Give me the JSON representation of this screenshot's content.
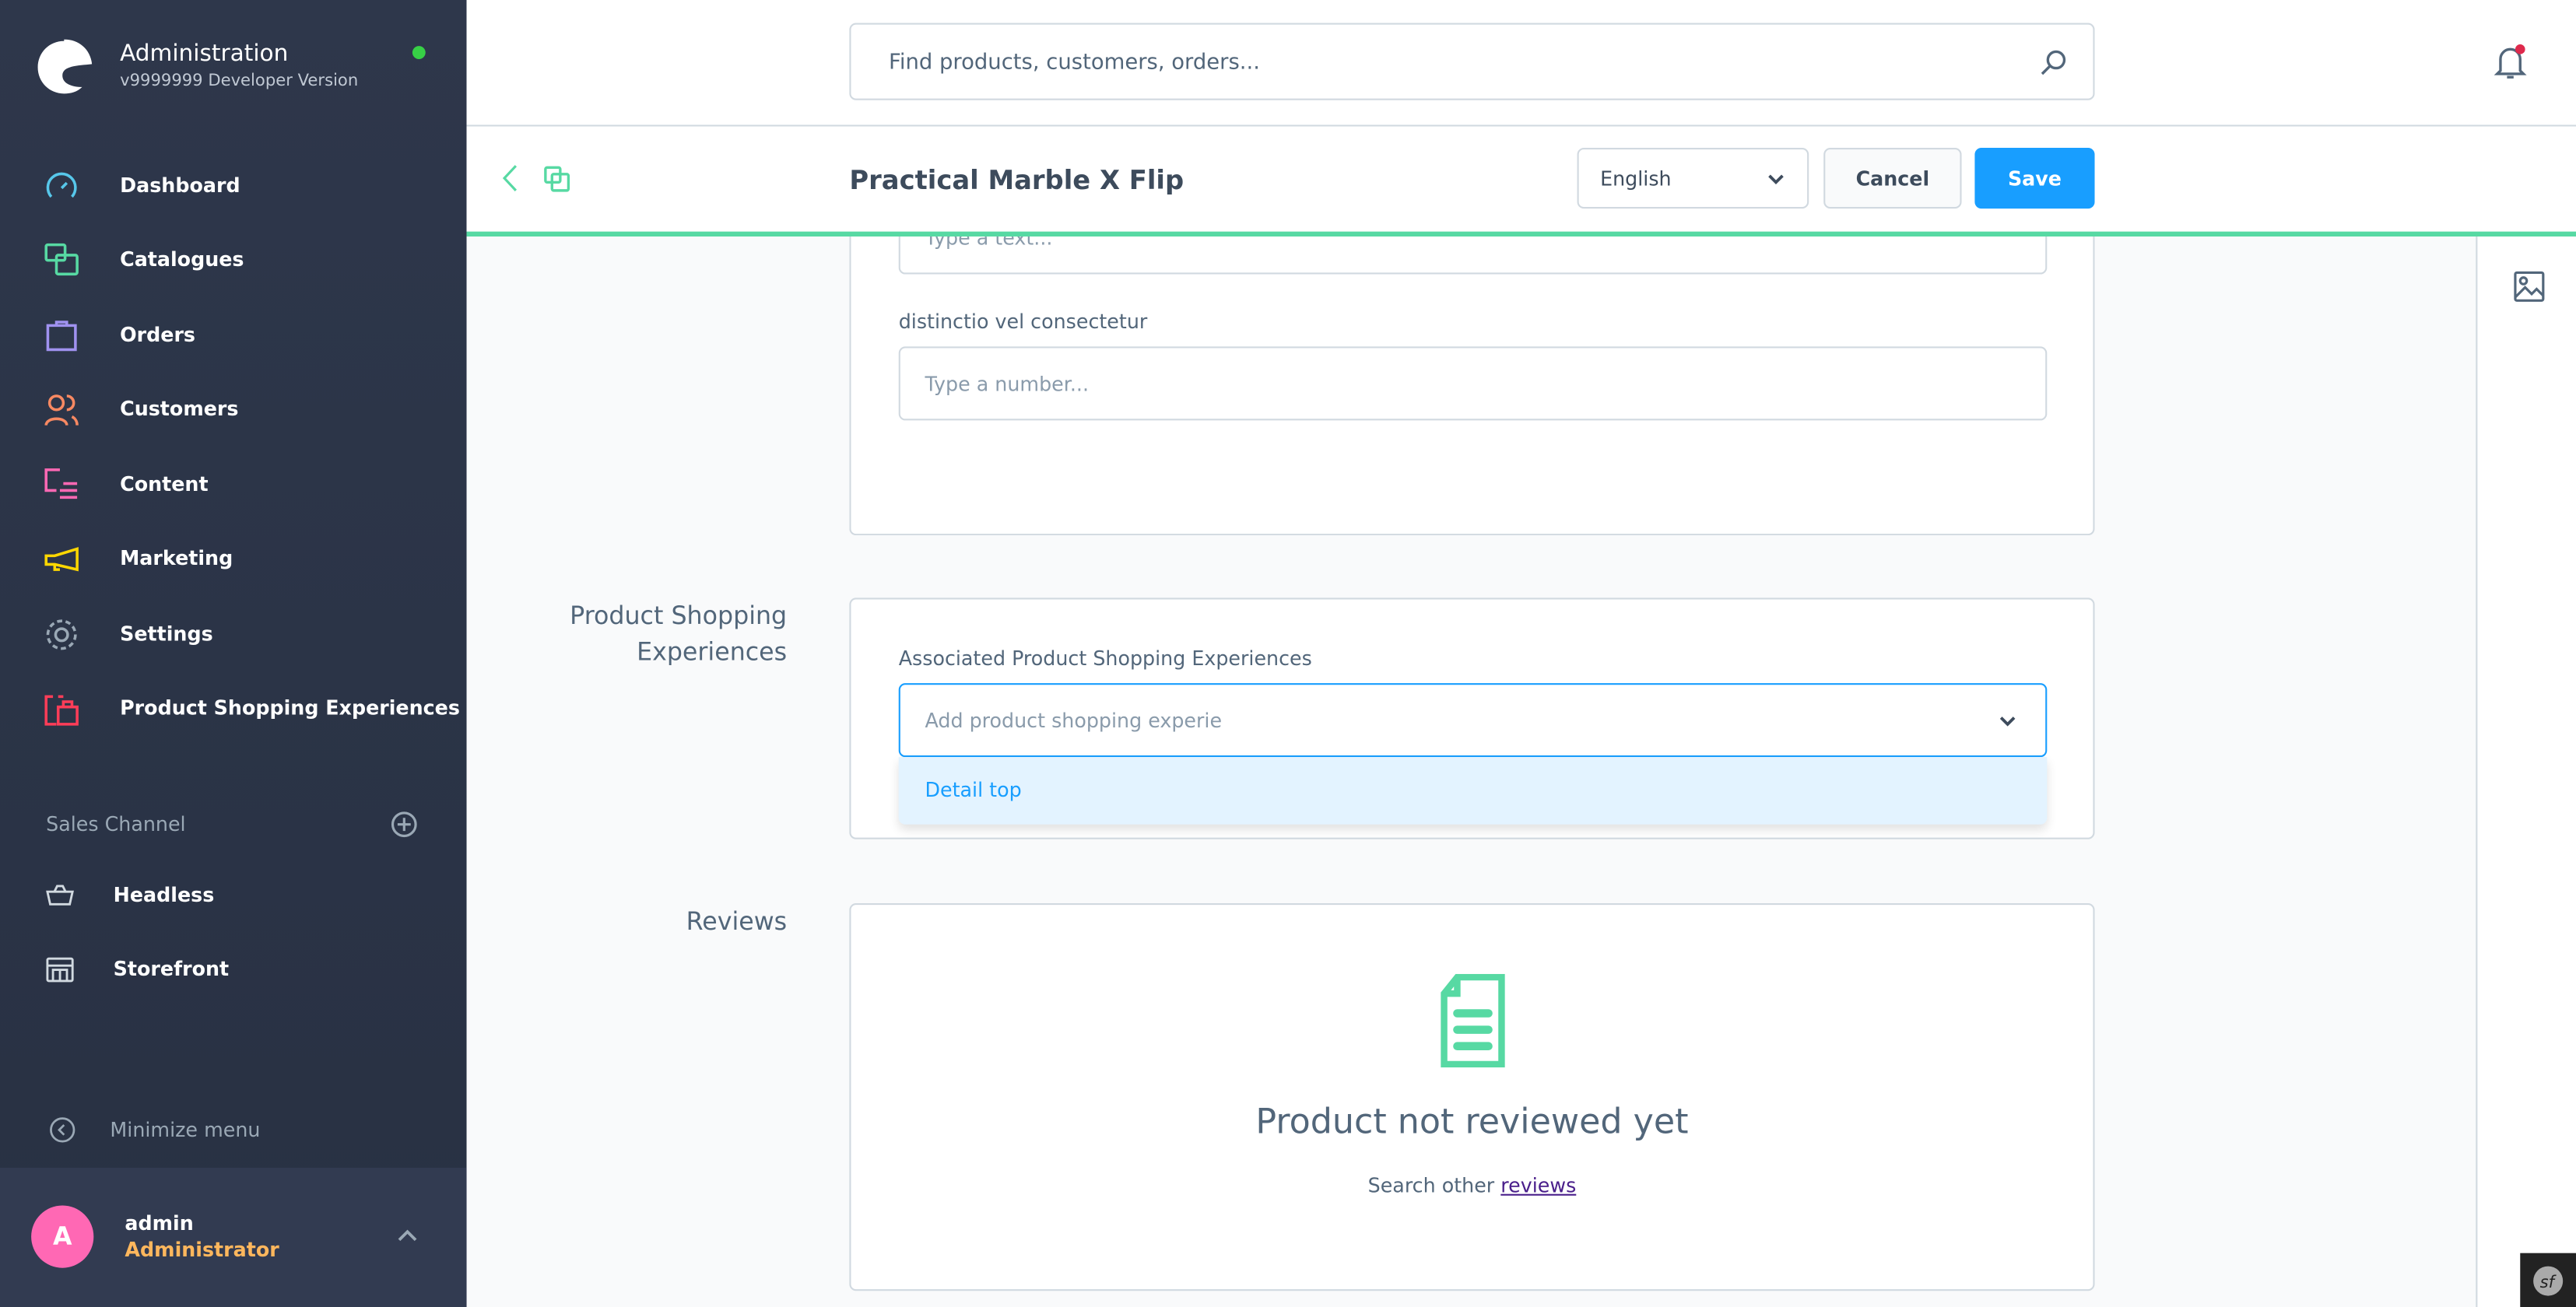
{
  "app": {
    "title": "Administration",
    "version": "v9999999 Developer Version",
    "status_color": "#37d046"
  },
  "nav": [
    {
      "label": "Dashboard",
      "icon": "dashboard-icon",
      "color": "#57c7ea"
    },
    {
      "label": "Catalogues",
      "icon": "catalogues-icon",
      "color": "#57d9a3"
    },
    {
      "label": "Orders",
      "icon": "orders-icon",
      "color": "#a092f0"
    },
    {
      "label": "Customers",
      "icon": "customers-icon",
      "color": "#f88962"
    },
    {
      "label": "Content",
      "icon": "content-icon",
      "color": "#ff68b4"
    },
    {
      "label": "Marketing",
      "icon": "marketing-icon",
      "color": "#ffd700"
    },
    {
      "label": "Settings",
      "icon": "settings-icon",
      "color": "#9aa8b5"
    },
    {
      "label": "Product Shopping Experiences",
      "icon": "shopping-experiences-icon",
      "color": "#ff3d58"
    }
  ],
  "sales_channel": {
    "title": "Sales Channel",
    "items": [
      {
        "label": "Headless",
        "icon": "basket-icon"
      },
      {
        "label": "Storefront",
        "icon": "storefront-icon"
      }
    ]
  },
  "minimize_label": "Minimize menu",
  "user": {
    "initial": "A",
    "name": "admin",
    "role": "Administrator",
    "avatar_color": "#ff68b4",
    "role_color": "#ffb75d"
  },
  "search": {
    "placeholder": "Find products, customers, orders..."
  },
  "smartbar": {
    "title": "Practical Marble X Flip",
    "language": "English",
    "cancel": "Cancel",
    "save": "Save",
    "accent": "#189eff"
  },
  "card1": {
    "text_placeholder": "Type a text...",
    "field_label": "distinctio vel consectetur",
    "number_placeholder": "Type a number..."
  },
  "shopping": {
    "section_title": "Product Shopping Experiences",
    "field_label": "Associated Product Shopping Experiences",
    "placeholder": "Add product shopping experie",
    "options": [
      "Detail top"
    ]
  },
  "reviews": {
    "section_title": "Reviews",
    "empty_title": "Product not reviewed yet",
    "search_prefix": "Search other",
    "search_link": "reviews"
  }
}
